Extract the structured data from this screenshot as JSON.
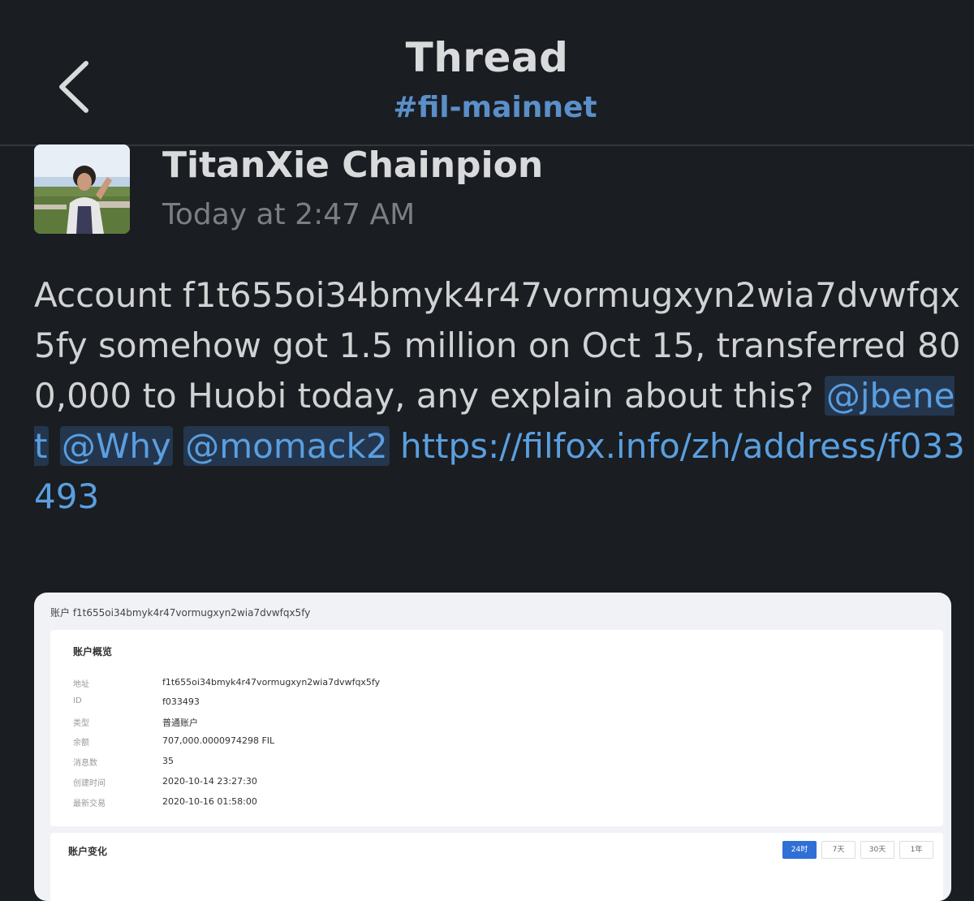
{
  "header": {
    "title": "Thread",
    "channel": "#fil-mainnet"
  },
  "message": {
    "author": "TitanXie Chainpion",
    "time": "Today at 2:47 AM",
    "text_before": "Account f1t655oi34bmyk4r47vormugxyn2wia7dvwfqx5fy somehow got 1.5 million on Oct 15, transferred 800,000 to Huobi today, any explain about this? ",
    "mentions": [
      "@jbenet",
      "@Why",
      "@momack2"
    ],
    "link": "https://filfox.info/zh/address/f033493"
  },
  "screenshot": {
    "title": "账户 f1t655oi34bmyk4r47vormugxyn2wia7dvwfqx5fy",
    "overview_title": "账户概览",
    "rows": [
      {
        "label": "地址",
        "value": "f1t655oi34bmyk4r47vormugxyn2wia7dvwfqx5fy"
      },
      {
        "label": "ID",
        "value": "f033493"
      },
      {
        "label": "类型",
        "value": "普通账户"
      },
      {
        "label": "余额",
        "value": "707,000.0000974298 FIL"
      },
      {
        "label": "消息数",
        "value": "35"
      },
      {
        "label": "创建时间",
        "value": "2020-10-14 23:27:30"
      },
      {
        "label": "最新交易",
        "value": "2020-10-16 01:58:00"
      }
    ],
    "changes_title": "账户变化",
    "ranges": [
      "24时",
      "7天",
      "30天",
      "1年"
    ],
    "active_range": "24时"
  },
  "colors": {
    "background": "#1a1d21",
    "link": "#5a9fe0",
    "mention_bg": "#24364e",
    "channel": "#5a8fc9"
  }
}
